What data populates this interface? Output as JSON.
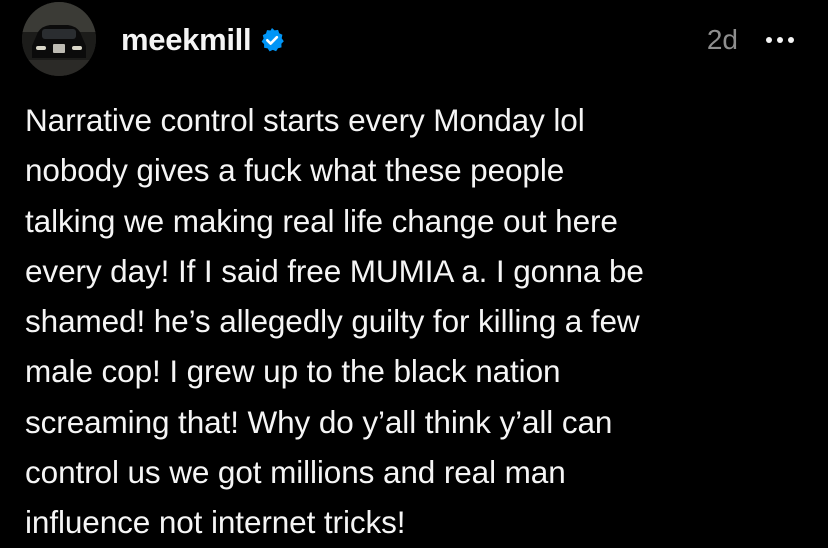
{
  "post": {
    "author": {
      "username": "meekmill",
      "verified": true,
      "avatar_icon": "avatar-car-photo"
    },
    "timestamp": "2d",
    "more_icon": "more-horizontal-icon",
    "verified_icon": "verified-badge-icon",
    "text": "Narrative control starts every Monday lol\nnobody gives a fuck what these people\ntalking we making real life change out here\nevery day! If I said free MUMIA a. I gonna be\nshamed!  he’s  allegedly guilty for killing a few\nmale cop! I grew up to the black nation\nscreaming that!  Why do y’all think y’all can\ncontrol us we got millions and real man\ninfluence not internet tricks!"
  },
  "colors": {
    "background": "#000000",
    "text": "#f5f5f5",
    "muted": "#8e8e8e",
    "verified_blue": "#0095f6"
  }
}
